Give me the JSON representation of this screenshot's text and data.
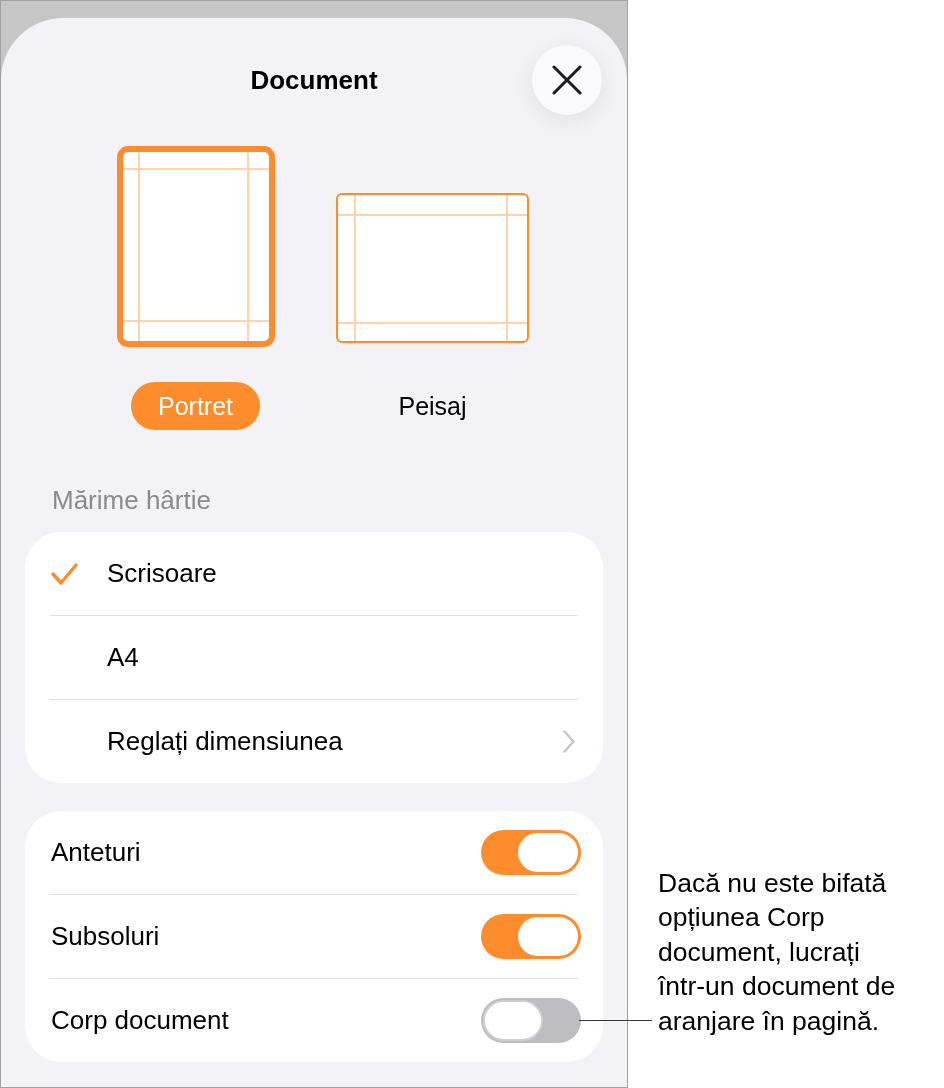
{
  "sheet": {
    "title": "Document"
  },
  "orientations": [
    {
      "kind": "portrait",
      "label": "Portret",
      "selected": true
    },
    {
      "kind": "landscape",
      "label": "Peisaj",
      "selected": false
    }
  ],
  "paper_size": {
    "heading": "Mărime hârtie",
    "options": [
      {
        "kind": "option",
        "label": "Scrisoare",
        "selected": true
      },
      {
        "kind": "option",
        "label": "A4",
        "selected": false
      },
      {
        "kind": "disclosure",
        "label": "Reglați dimensiunea",
        "selected": false
      }
    ]
  },
  "toggles": [
    {
      "label": "Anteturi",
      "on": true
    },
    {
      "label": "Subsoluri",
      "on": true
    },
    {
      "label": "Corp document",
      "on": false
    }
  ],
  "callout": {
    "text": "Dacă nu este bifată opțiunea Corp document, lucrați într-un document de aranjare în pagină."
  }
}
